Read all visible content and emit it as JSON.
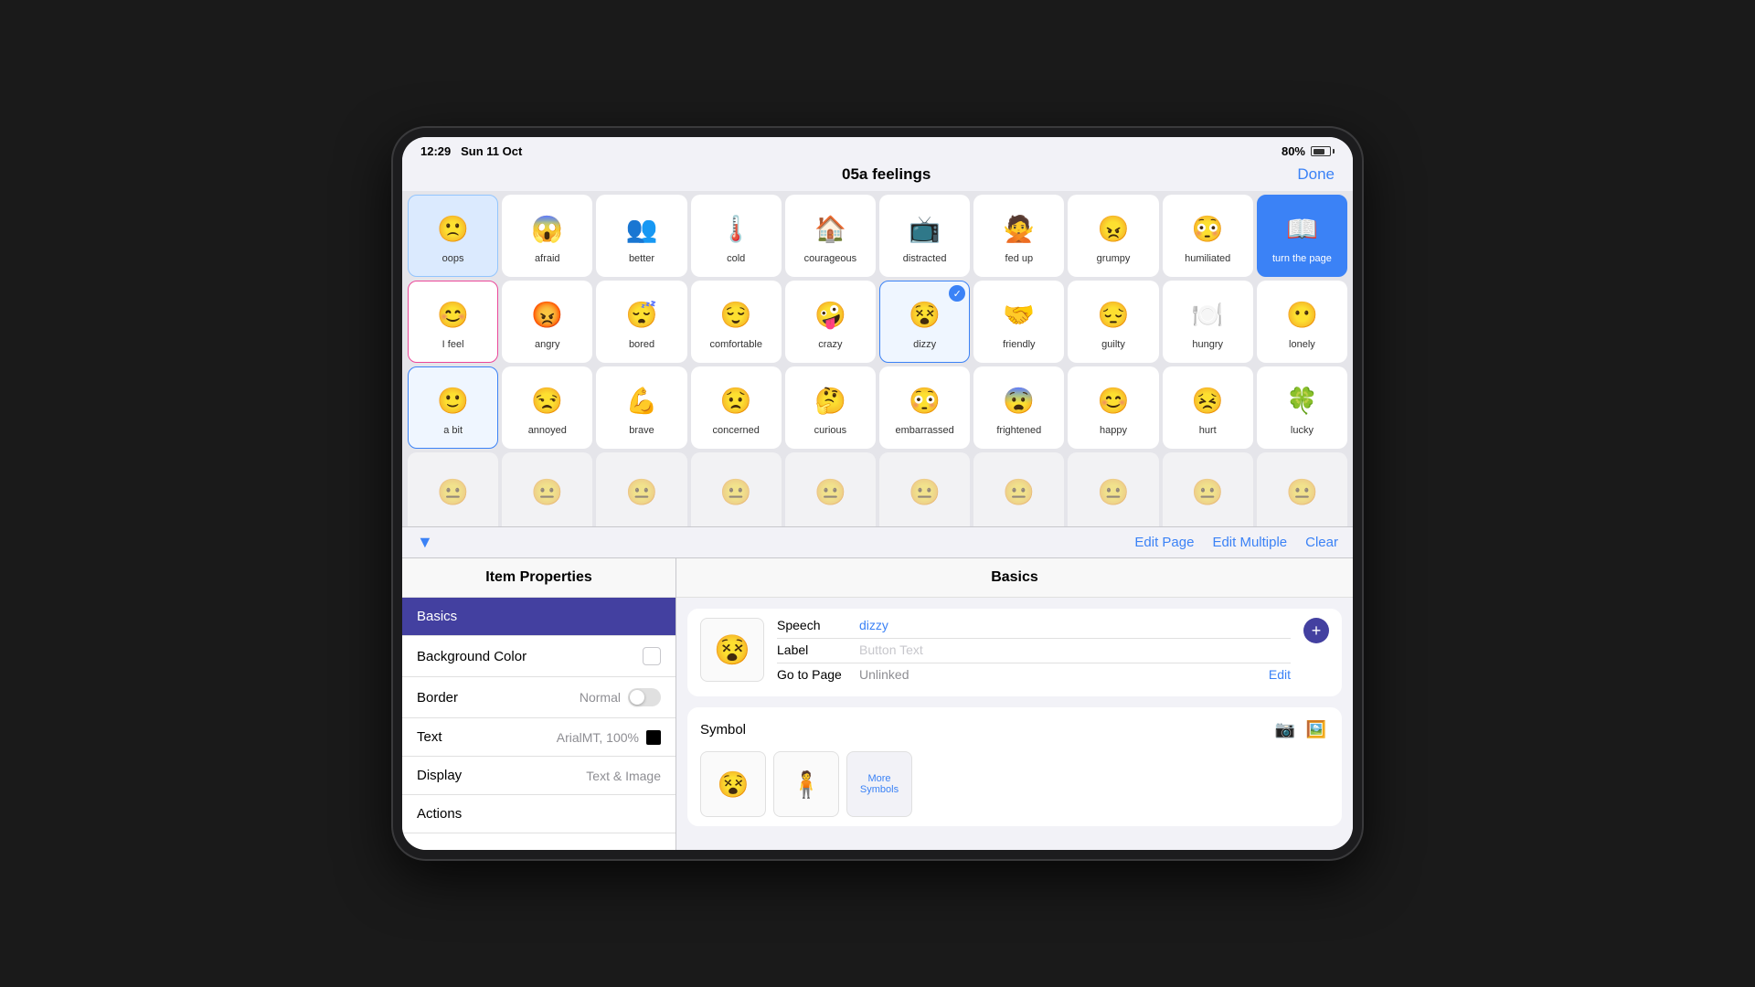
{
  "statusBar": {
    "time": "12:29",
    "date": "Sun 11 Oct",
    "battery": "80%"
  },
  "navBar": {
    "title": "05a feelings",
    "doneLabel": "Done"
  },
  "grid": {
    "rows": [
      [
        {
          "id": "oops",
          "label": "oops",
          "icon": "oops-icon",
          "style": "special-blue"
        },
        {
          "id": "afraid",
          "label": "afraid",
          "icon": "afraid-icon"
        },
        {
          "id": "better",
          "label": "better",
          "icon": "better-icon"
        },
        {
          "id": "cold",
          "label": "cold",
          "icon": "cold-icon"
        },
        {
          "id": "courageous",
          "label": "courageous",
          "icon": "courageous-icon"
        },
        {
          "id": "distracted",
          "label": "distracted",
          "icon": "distracted-icon"
        },
        {
          "id": "fed-up",
          "label": "fed up",
          "icon": "fed-up-icon"
        },
        {
          "id": "grumpy",
          "label": "grumpy",
          "icon": "grumpy-icon"
        },
        {
          "id": "humiliated",
          "label": "humiliated",
          "icon": "humiliated-icon"
        },
        {
          "id": "turn-the-page",
          "label": "turn the page",
          "icon": "turn-page-icon",
          "style": "turn-page"
        }
      ],
      [
        {
          "id": "i-feel",
          "label": "I feel",
          "icon": "i-feel-icon",
          "style": "selected-pink"
        },
        {
          "id": "angry",
          "label": "angry",
          "icon": "angry-icon"
        },
        {
          "id": "bored",
          "label": "bored",
          "icon": "bored-icon"
        },
        {
          "id": "comfortable",
          "label": "comfortable",
          "icon": "comfortable-icon"
        },
        {
          "id": "crazy",
          "label": "crazy",
          "icon": "crazy-icon"
        },
        {
          "id": "dizzy",
          "label": "dizzy",
          "icon": "dizzy-icon",
          "checked": true
        },
        {
          "id": "friendly",
          "label": "friendly",
          "icon": "friendly-icon"
        },
        {
          "id": "guilty",
          "label": "guilty",
          "icon": "guilty-icon"
        },
        {
          "id": "hungry",
          "label": "hungry",
          "icon": "hungry-icon"
        },
        {
          "id": "lonely",
          "label": "lonely",
          "icon": "lonely-icon"
        }
      ],
      [
        {
          "id": "a-bit",
          "label": "a bit",
          "icon": "a-bit-icon",
          "style": "selected-blue"
        },
        {
          "id": "annoyed",
          "label": "annoyed",
          "icon": "annoyed-icon"
        },
        {
          "id": "brave",
          "label": "brave",
          "icon": "brave-icon"
        },
        {
          "id": "concerned",
          "label": "concerned",
          "icon": "concerned-icon"
        },
        {
          "id": "curious",
          "label": "curious",
          "icon": "curious-icon"
        },
        {
          "id": "embarrassed",
          "label": "embarrassed",
          "icon": "embarrassed-icon"
        },
        {
          "id": "frightened",
          "label": "frightened",
          "icon": "frightened-icon"
        },
        {
          "id": "happy",
          "label": "happy",
          "icon": "happy-icon"
        },
        {
          "id": "hurt",
          "label": "hurt",
          "icon": "hurt-icon"
        },
        {
          "id": "lucky",
          "label": "lucky",
          "icon": "lucky-icon"
        }
      ],
      [
        {
          "id": "row4-1",
          "label": "...",
          "icon": ""
        },
        {
          "id": "row4-2",
          "label": "...",
          "icon": ""
        },
        {
          "id": "row4-3",
          "label": "...",
          "icon": ""
        },
        {
          "id": "row4-4",
          "label": "...",
          "icon": ""
        },
        {
          "id": "row4-5",
          "label": "...",
          "icon": ""
        },
        {
          "id": "row4-6",
          "label": "...",
          "icon": ""
        },
        {
          "id": "row4-7",
          "label": "...",
          "icon": ""
        },
        {
          "id": "row4-8",
          "label": "...",
          "icon": ""
        },
        {
          "id": "row4-9",
          "label": "...",
          "icon": ""
        },
        {
          "id": "row4-10",
          "label": "...",
          "icon": ""
        }
      ]
    ]
  },
  "toolbar": {
    "chevronDown": "▼",
    "editPageLabel": "Edit Page",
    "editMultipleLabel": "Edit Multiple",
    "clearLabel": "Clear"
  },
  "itemProperties": {
    "title": "Item Properties",
    "items": [
      {
        "id": "basics",
        "label": "Basics",
        "active": true
      },
      {
        "id": "background-color",
        "label": "Background Color",
        "value": ""
      },
      {
        "id": "border",
        "label": "Border",
        "value": "Normal"
      },
      {
        "id": "text",
        "label": "Text",
        "value": "ArialMT, 100%"
      },
      {
        "id": "display",
        "label": "Display",
        "value": "Text & Image"
      },
      {
        "id": "actions",
        "label": "Actions",
        "value": ""
      }
    ]
  },
  "basics": {
    "title": "Basics",
    "speech": {
      "label": "Speech",
      "value": "dizzy"
    },
    "labelField": {
      "label": "Label",
      "placeholder": "Button Text"
    },
    "goToPage": {
      "label": "Go to Page",
      "value": "Unlinked",
      "editLabel": "Edit"
    },
    "symbol": {
      "title": "Symbol",
      "cameraIcon": "📷",
      "imageIcon": "🖼️",
      "moreLabel": "More Symbols"
    }
  }
}
